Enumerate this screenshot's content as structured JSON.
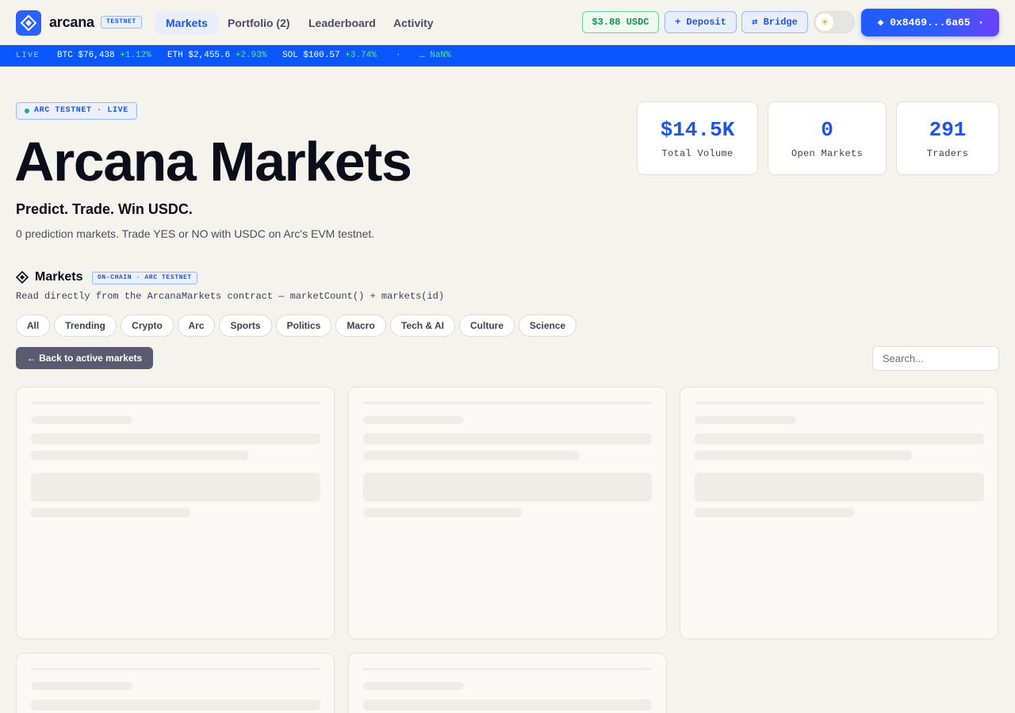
{
  "nav": {
    "brand": "arcana",
    "network_badge": "TESTNET",
    "links": [
      "Markets",
      "Portfolio (2)",
      "Leaderboard",
      "Activity"
    ],
    "balance": "$3.88 USDC",
    "deposit_label": "+ Deposit",
    "bridge_label": "⇄ Bridge",
    "theme_icon": "☀",
    "wallet_label": "◆ 0x8469...6a65",
    "wallet_caret": "▾"
  },
  "ticker": {
    "live_label": "LIVE",
    "items": [
      {
        "symbol": "BTC",
        "price": "$76,438",
        "change": "+1.12%"
      },
      {
        "symbol": "ETH",
        "price": "$2,455.6",
        "change": "+2.93%"
      },
      {
        "symbol": "SOL",
        "price": "$100.57",
        "change": "+3.74%"
      }
    ],
    "separator": "·",
    "trailing_symbol": "…",
    "trailing_change": "NaN%"
  },
  "hero": {
    "badge": "ARC TESTNET · LIVE",
    "title": "Arcana Markets",
    "tagline": "Predict. Trade. Win USDC.",
    "subline": "0 prediction markets. Trade YES or NO with USDC on Arc's EVM testnet."
  },
  "stats": [
    {
      "value": "$14.5K",
      "label": "Total Volume"
    },
    {
      "value": "0",
      "label": "Open Markets"
    },
    {
      "value": "291",
      "label": "Traders"
    }
  ],
  "markets": {
    "icon": "◈",
    "title": "Markets",
    "badge": "ON-CHAIN · ARC TESTNET",
    "description": "Read directly from the ArcanaMarkets contract — marketCount() + markets(id)",
    "filters": [
      "All",
      "Trending",
      "Crypto",
      "Arc",
      "Sports",
      "Politics",
      "Macro",
      "Tech & AI",
      "Culture",
      "Science"
    ],
    "back_label": "← Back to active markets",
    "search_placeholder": "Search..."
  },
  "colors": {
    "accent": "#1f55e0",
    "ticker_bg": "#0a57ff",
    "positive": "#4ef08e",
    "background": "#f4f3ee"
  }
}
